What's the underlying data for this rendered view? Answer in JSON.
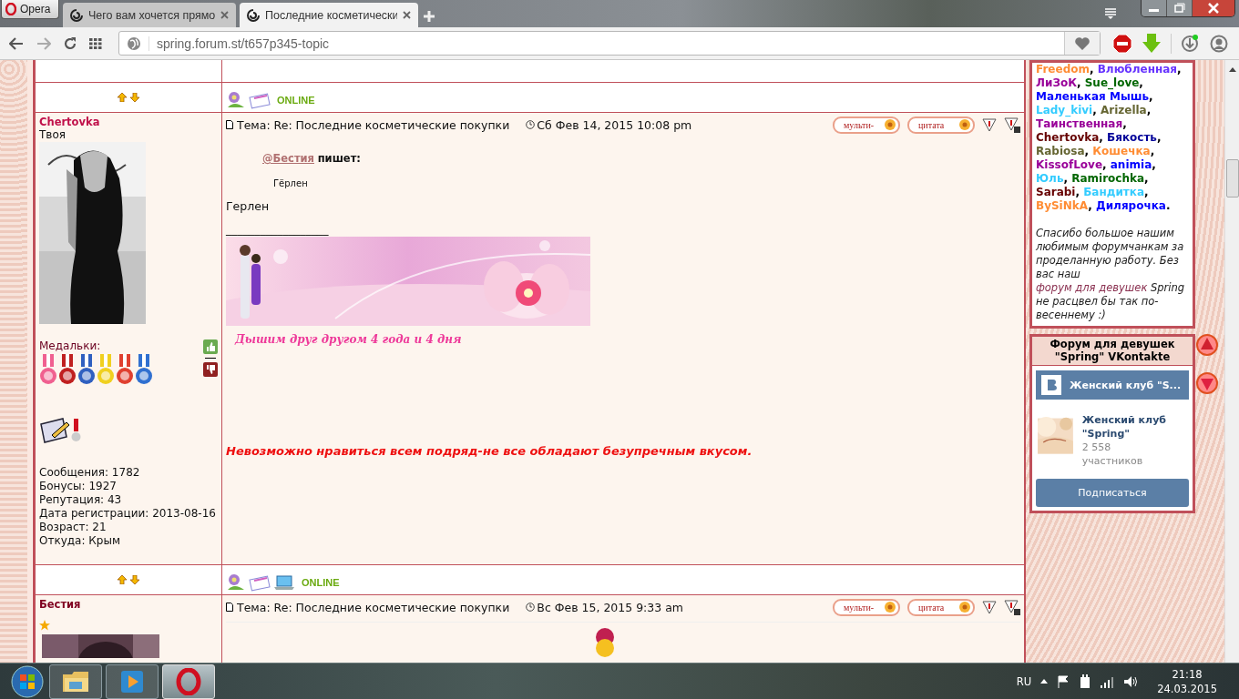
{
  "browser": {
    "opera_button": "Opera",
    "tabs": [
      {
        "title": "Чего вам хочется прямо",
        "selected": false
      },
      {
        "title": "Последние косметически",
        "selected": true
      }
    ],
    "url": "spring.forum.st/t657p345-topic"
  },
  "posts": [
    {
      "contact_icons": [
        {
          "kind": "profile"
        },
        {
          "kind": "message"
        }
      ],
      "online": "ONLINE",
      "author": "Chertovka",
      "rank": "Твоя",
      "avatar": {
        "kind": "picture"
      },
      "medals_label": "Медальки:",
      "stats": [
        "Сообщения: 1782",
        "Бонусы: 1927",
        "Репутация: 43",
        "Дата регистрации: 2013-08-16",
        "Возраст: 21",
        "Откуда: Крым"
      ],
      "subject": "Тема: Re: Последние косметические покупки",
      "date": "Сб Фев 14, 2015 10:08 pm",
      "buttons": [
        "мульти-",
        "цитата"
      ],
      "quote": {
        "author": "@Бестия",
        "verb": "пишет:",
        "text": "Гёрлен"
      },
      "body": "Герлен",
      "signature_rule": "__________________",
      "signature_caption": "Дышим друг другом 4 года и 4 дня",
      "motto": "Невозможно нравиться всем подряд-не все обладают безупречным вкусом."
    },
    {
      "contact_icons": [
        {
          "kind": "profile"
        },
        {
          "kind": "message"
        },
        {
          "kind": "website"
        }
      ],
      "online": "ONLINE",
      "author": "Бестия",
      "avatar": {
        "kind": "picture"
      },
      "subject": "Тема: Re: Последние косметические покупки",
      "date": "Вс Фев 15, 2015 9:33 am",
      "buttons": [
        "мульти-",
        "цитата"
      ]
    }
  ],
  "sidebar": {
    "members": [
      {
        "name": "Freedom",
        "color": "#ff8c33",
        "suffix": ","
      },
      {
        "name": "Влюбленная",
        "color": "#6633ff",
        "suffix": ","
      },
      {
        "name": "ЛиЗоК",
        "color": "#990099",
        "suffix": ","
      },
      {
        "name": "Sue_love",
        "color": "#006600",
        "suffix": ","
      },
      {
        "name": "Маленькая Мышь",
        "color": "#0000ff",
        "suffix": ","
      },
      {
        "name": "Lady_kivi",
        "color": "#33ccff",
        "suffix": ","
      },
      {
        "name": "Arizella",
        "color": "#666633",
        "suffix": ","
      },
      {
        "name": "Таинственная",
        "color": "#990099",
        "suffix": ","
      },
      {
        "name": "Chertovka",
        "color": "#660000",
        "suffix": ","
      },
      {
        "name": "Бякость",
        "color": "#000099",
        "suffix": ","
      },
      {
        "name": "Rabiosa",
        "color": "#666633",
        "suffix": ","
      },
      {
        "name": "Кошечка",
        "color": "#ff8c33",
        "suffix": ","
      },
      {
        "name": "KissofLove",
        "color": "#990099",
        "suffix": ","
      },
      {
        "name": "animia",
        "color": "#0000ff",
        "suffix": ","
      },
      {
        "name": "Юль",
        "color": "#33ccff",
        "suffix": ","
      },
      {
        "name": "Ramirochka",
        "color": "#006600",
        "suffix": ","
      },
      {
        "name": "Sarabi",
        "color": "#660000",
        "suffix": ","
      },
      {
        "name": "Бандитка",
        "color": "#33ccff",
        "suffix": ","
      },
      {
        "name": "BySiNkA",
        "color": "#ff8c33",
        "suffix": ","
      },
      {
        "name": "Дилярочка",
        "color": "#0000ff",
        "suffix": "."
      }
    ],
    "thanks": {
      "before": "Спасибо большое нашим любимым форумчанкам за проделанную работу. Без вас наш",
      "link": "форум для девушек",
      "after": "Spring не расцвел бы так по-весеннему :)"
    },
    "vk": {
      "header": "Форум для девушек \"Spring\" VKontakte",
      "group_bar": "Женский клуб \"S...",
      "group_name": "Женский клуб \"Spring\"",
      "count": "2 558",
      "count_label": "участников",
      "subscribe": "Подписаться"
    }
  },
  "taskbar": {
    "apps": [
      {
        "kind": "explorer",
        "selected": false
      },
      {
        "kind": "media",
        "selected": false
      },
      {
        "kind": "opera",
        "selected": true
      }
    ],
    "language": "RU",
    "time": "21:18",
    "date": "24.03.2015"
  }
}
